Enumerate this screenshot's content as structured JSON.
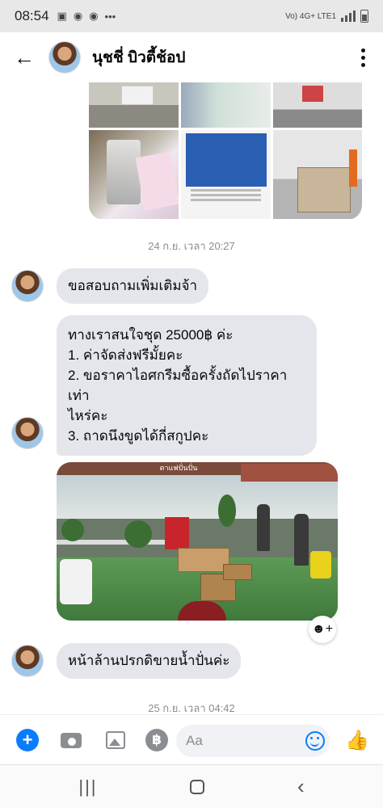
{
  "status_bar": {
    "time": "08:54",
    "network": "Vo) 4G+ LTE1"
  },
  "header": {
    "title": "นุชชี่ บิวตี้ช้อป"
  },
  "timestamps": [
    "24 ก.ย. เวลา 20:27",
    "25 ก.ย. เวลา 04:42"
  ],
  "messages": {
    "m1": "ขอสอบถามเพิ่มเติมจ้า",
    "m2": {
      "line1": "ทางเราสนใจชุด 25000฿ ค่ะ",
      "line2": "1. ค่าจัดส่งฟรีมั้ยคะ",
      "line3": "2. ขอราคาไอศกรีมซื้อครั้งถัดไปราคาเท่า",
      "line4": "ไหร่คะ",
      "line5": "3. ถาดนึงขูดได้กี่สกูปคะ"
    },
    "m3": "หน้าล้านปรกดิขายน้ำปั่นค่ะ"
  },
  "photo_sign": "ตาแฟปั่นปั่น",
  "composer": {
    "placeholder": "Aa",
    "baht_symbol": "฿",
    "plus_symbol": "+"
  },
  "icons": {
    "back": "arrow-left-icon",
    "menu": "more-vertical-icon",
    "plus": "plus-icon",
    "camera": "camera-icon",
    "image": "image-icon",
    "baht": "baht-icon",
    "emoji": "emoji-icon",
    "like": "thumbs-up-icon",
    "react": "add-reaction-icon"
  },
  "colors": {
    "accent": "#0a7cff",
    "bubble": "#e4e6eb",
    "timestamp": "#8a8d91"
  }
}
